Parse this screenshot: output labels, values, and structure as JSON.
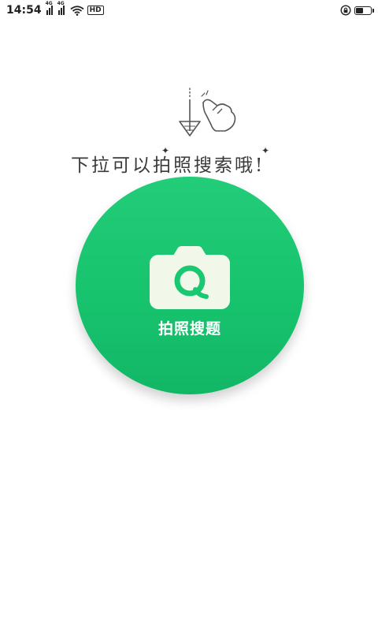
{
  "status_bar": {
    "time": "14:54",
    "signal_1_label": "4G",
    "signal_2_label": "4G",
    "hd_label": "HD",
    "battery_level": 0.55
  },
  "hint": {
    "text": "下拉可以拍照搜索哦!"
  },
  "search_button": {
    "label": "拍照搜题"
  },
  "colors": {
    "accent_green": "#1ac871",
    "camera_fill": "#f1f8e9"
  }
}
